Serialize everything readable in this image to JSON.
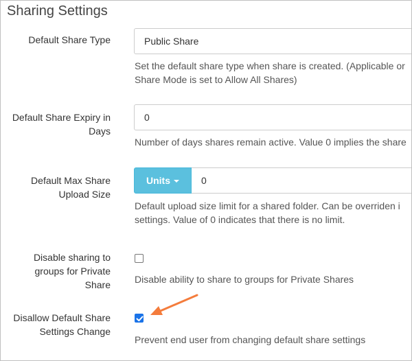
{
  "section": {
    "title": "Sharing Settings"
  },
  "settings": {
    "share_type": {
      "label": "Default Share Type",
      "value": "Public Share",
      "help_line1": "Set the default share type when share is created. (Applicable or",
      "help_line2": "Share Mode is set to Allow All Shares)"
    },
    "expiry": {
      "label_line1": "Default Share Expiry in",
      "label_line2": "Days",
      "value": "0",
      "help": "Number of days shares remain active. Value 0 implies the share"
    },
    "max_upload": {
      "label_line1": "Default Max Share",
      "label_line2": "Upload Size",
      "units_label": "Units",
      "value": "0",
      "help_line1": "Default upload size limit for a shared folder. Can be overriden i",
      "help_line2": "settings. Value of 0 indicates that there is no limit."
    },
    "disable_groups": {
      "label_line1": "Disable sharing to",
      "label_line2": "groups for Private",
      "label_line3": "Share",
      "checked": false,
      "help": "Disable ability to share to groups for Private Shares"
    },
    "disallow_change": {
      "label_line1": "Disallow Default Share",
      "label_line2": "Settings Change",
      "checked": true,
      "help": "Prevent end user from changing default share settings"
    }
  },
  "colors": {
    "units_button": "#5bc0de",
    "checkbox_checked": "#1a73e8",
    "annotation_arrow": "#f47c3c"
  },
  "icons": [
    "caret-down-icon",
    "checkmark-icon",
    "annotation-arrow-icon"
  ]
}
